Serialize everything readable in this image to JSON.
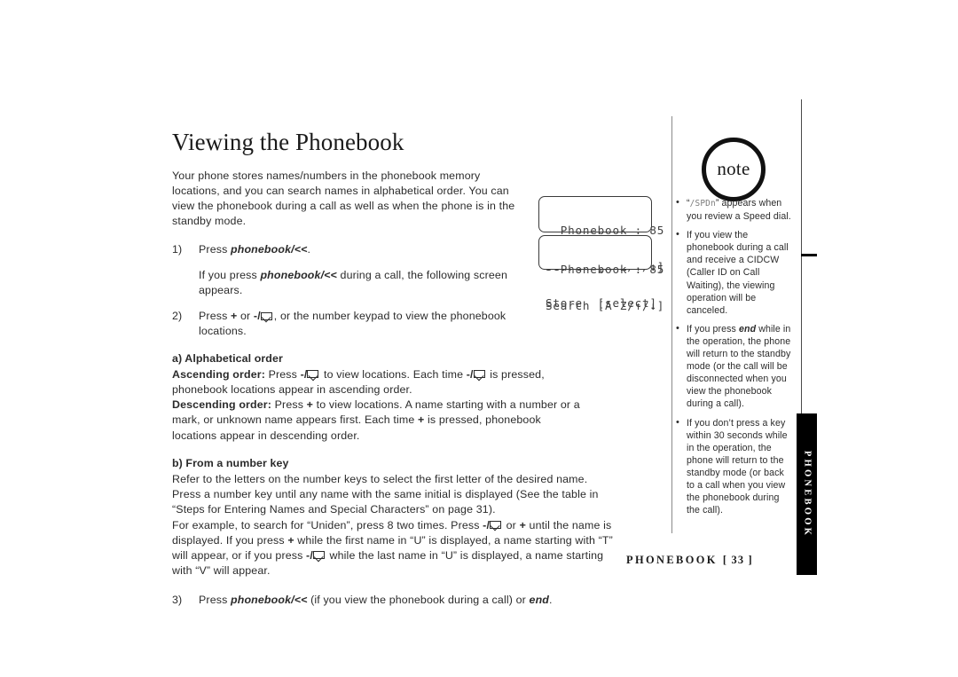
{
  "page": {
    "title": "Viewing the Phonebook",
    "intro": "Your phone stores names/numbers in the phonebook memory locations, and you can search names in alphabetical order. You can view the phonebook during a call as well as when the phone is in the standby mode.",
    "footer_section": "PHONEBOOK",
    "footer_page": "[ 33 ]",
    "side_tab_label": "PHONEBOOK"
  },
  "steps": {
    "step1_num": "1)",
    "step1_pre": "Press ",
    "step1_key": "phonebook/<<",
    "step1_post": ".",
    "step1_note_a": "If you press ",
    "step1_note_key": "phonebook/<<",
    "step1_note_b": " during a call, the following screen appears.",
    "step2_num": "2)",
    "step2_a": "Press ",
    "step2_key_plus": "+",
    "step2_b": " or ",
    "step2_key_minus": "-/",
    "step2_c": ", or the number keypad to view the phonebook locations.",
    "step3_num": "3)",
    "step3_a": "Press ",
    "step3_key": "phonebook/<<",
    "step3_b": " (if you view the phonebook during a call) or ",
    "step3_key_end": "end",
    "step3_c": "."
  },
  "section_a": {
    "heading": "a) Alphabetical order",
    "ascending_label": "Ascending order:",
    "ascending_1": " Press ",
    "ascending_key": "-/",
    "ascending_2": " to view locations. Each time ",
    "ascending_3": " is pressed, phonebook locations appear in ascending order.",
    "descending_label": "Descending order:",
    "descending_1": " Press ",
    "descending_key_plus": "+",
    "descending_2": " to view locations. A name starting with a number or a mark, or unknown name appears first. Each time ",
    "descending_3": " is pressed, phonebook locations appear in descending order."
  },
  "section_b": {
    "heading": "b) From a number key",
    "para1": "Refer to the letters on the number keys to select the first letter of the desired name. Press a number key until any name with the same initial is displayed (See the table in “Steps for Entering Names and Special Characters” on page 31).",
    "para2_a": "For example, to search for “Uniden”, press 8 two times. Press ",
    "para2_key1": "-/",
    "para2_b": " or ",
    "para2_key_plus": "+",
    "para2_c": " until the name is displayed. If you press ",
    "para2_d": " while the first name in “U” is displayed, a name starting with “T” will appear, or if you press ",
    "para2_key2": "-/",
    "para2_e": " while the last name in “U” is displayed, a name starting with “V” will appear."
  },
  "lcd_screens": [
    {
      "id": "lcd-1",
      "lines": [
        "  Phonebook : 85",
        "Search [A-Z/↑/↓]",
        "Store  [select]"
      ]
    },
    {
      "id": "lcd-2",
      "lines": [
        "  Phonebook : 85",
        "Search [A-Z/↑/↓]"
      ]
    }
  ],
  "note_badge": {
    "label": "note"
  },
  "notes": [
    {
      "lcd_text": "/SPDn",
      "pre": "“",
      "post": "” appears when you review a Speed dial."
    },
    {
      "text": "If you view the phonebook during a call and receive a CIDCW (Caller ID on Call Waiting), the viewing operation will be canceled."
    },
    {
      "pre": "If you press ",
      "bold": "end",
      "post": " while in the operation, the phone will return to the standby mode (or the call will be disconnected when you view the phonebook during a call)."
    },
    {
      "text": "If you don’t press a key within 30 seconds while in the operation, the phone will return to the standby mode (or back to a call when you view the phonebook during the call)."
    }
  ],
  "colors": {
    "ink": "#231f20",
    "rule": "#8a8a8a",
    "tab_bg": "#000000",
    "lcd_text": "#404040"
  }
}
